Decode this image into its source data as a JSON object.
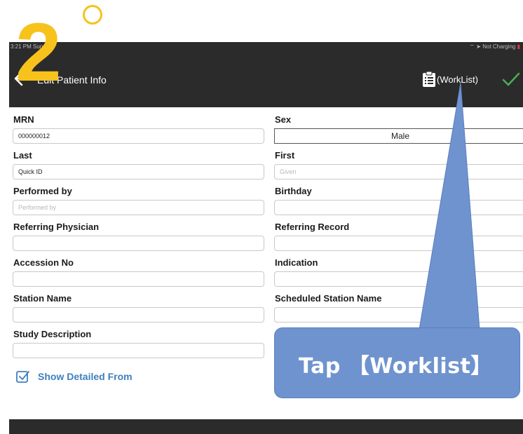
{
  "step": {
    "number": "2"
  },
  "status_bar": {
    "time": "3:21 PM  Sun",
    "battery": "Not Charging"
  },
  "navbar": {
    "title": "Edit Patient Info",
    "worklist_label": "(WorkList)"
  },
  "form": {
    "mrn_label": "MRN",
    "mrn_value": "000000012",
    "sex_label": "Sex",
    "sex_value": "Male",
    "last_label": "Last",
    "last_value": "Quick ID",
    "first_label": "First",
    "first_placeholder": "Given",
    "performed_label": "Performed by",
    "performed_placeholder": "Performed by",
    "birthday_label": "Birthday",
    "ref_phys_label": "Referring Physician",
    "ref_record_label": "Referring Record",
    "accession_label": "Accession No",
    "indication_label": "Indication",
    "station_label": "Station Name",
    "sched_station_label": "Scheduled Station Name",
    "study_desc_label": "Study Description",
    "show_detail_label": "Show Detailed From"
  },
  "callout": {
    "text": "Tap 【Worklist】"
  },
  "colors": {
    "accent_yellow": "#f7c21c",
    "callout_blue": "#6f93cf",
    "check_green": "#4caf50",
    "link_blue": "#3f7fbf",
    "bar_dark": "#2b2b2b"
  }
}
